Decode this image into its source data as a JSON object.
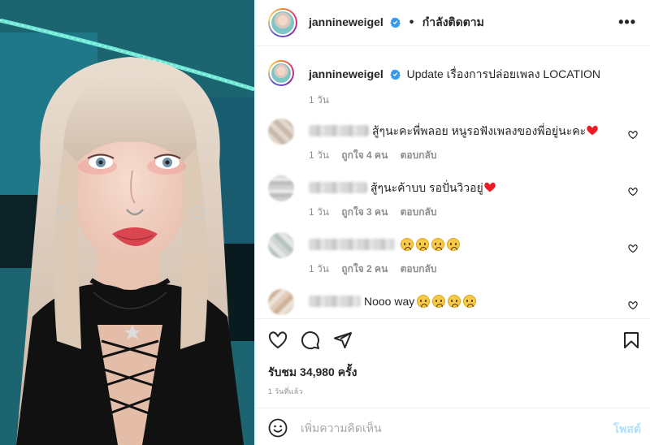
{
  "post": {
    "username": "jannineweigel",
    "following_label": "กำลังติดตาม",
    "dot": "•",
    "more_label": "•••",
    "caption": {
      "username": "jannineweigel",
      "text": "Update เรื่องการปล่อยเพลง LOCATION",
      "time": "1 วัน"
    },
    "comments": [
      {
        "text": "สู้ๆนะคะพี่พลอย หนูรอฟังเพลงของพี่อยู่นะคะ",
        "trailing": "red-heart",
        "time": "1 วัน",
        "likes": "ถูกใจ 4 คน",
        "reply": "ตอบกลับ"
      },
      {
        "text": "สู้ๆนะค้าบบ รอปั่นวิวอยู่",
        "trailing": "red-heart",
        "time": "1 วัน",
        "likes": "ถูกใจ 3 คน",
        "reply": "ตอบกลับ"
      },
      {
        "text": "",
        "trailing": "sad-emoji-x4",
        "time": "1 วัน",
        "likes": "ถูกใจ 2 คน",
        "reply": "ตอบกลับ"
      },
      {
        "text": "Nooo way",
        "trailing": "sad-emoji-x4",
        "time": "",
        "likes": "",
        "reply": ""
      }
    ],
    "views": "รับชม 34,980 ครั้ง",
    "posted_ago": "1 วันที่แล้ว",
    "comment_placeholder": "เพิ่มความคิดเห็น",
    "post_button": "โพสต์"
  },
  "colors": {
    "verified": "#3897f0",
    "post_button_disabled": "#b2dffc",
    "meta_gray": "#8e8e8e",
    "heart_red": "#ed1c24"
  }
}
